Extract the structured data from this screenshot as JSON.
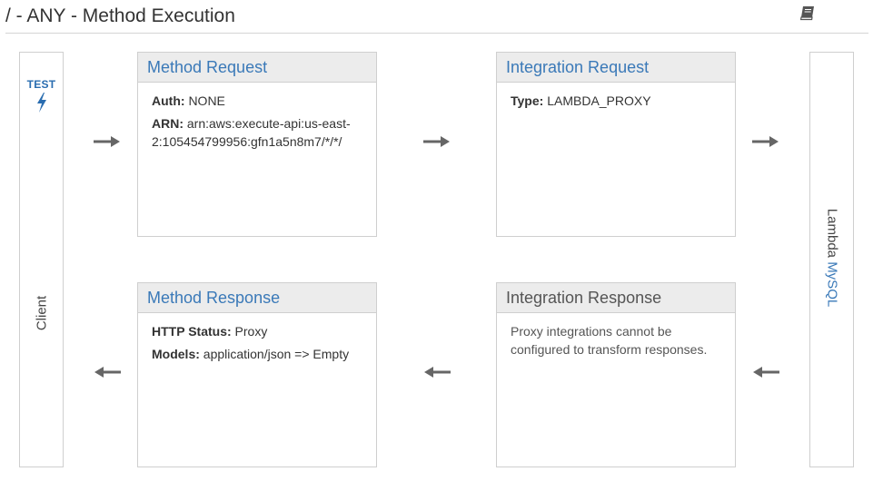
{
  "header": {
    "title": "/ - ANY - Method Execution"
  },
  "client": {
    "test_label": "TEST",
    "label": "Client"
  },
  "backend": {
    "prefix": "Lambda",
    "function_name": "MySQL"
  },
  "method_request": {
    "title": "Method Request",
    "auth_label": "Auth:",
    "auth_value": "NONE",
    "arn_label": "ARN:",
    "arn_value": "arn:aws:execute-api:us-east-2:105454799956:gfn1a5n8m7/*/*/"
  },
  "integration_request": {
    "title": "Integration Request",
    "type_label": "Type:",
    "type_value": "LAMBDA_PROXY"
  },
  "method_response": {
    "title": "Method Response",
    "status_label": "HTTP Status:",
    "status_value": "Proxy",
    "models_label": "Models:",
    "models_value": "application/json => Empty"
  },
  "integration_response": {
    "title": "Integration Response",
    "note": "Proxy integrations cannot be configured to transform responses."
  },
  "icons": {
    "docs": "book-icon",
    "test": "lightning-bolt-icon",
    "arrow_right": "arrow-right-icon",
    "arrow_left": "arrow-left-icon"
  },
  "colors": {
    "link": "#3a79b8",
    "header_bg": "#ececec",
    "border": "#cfcfcf",
    "arrow": "#666666"
  }
}
